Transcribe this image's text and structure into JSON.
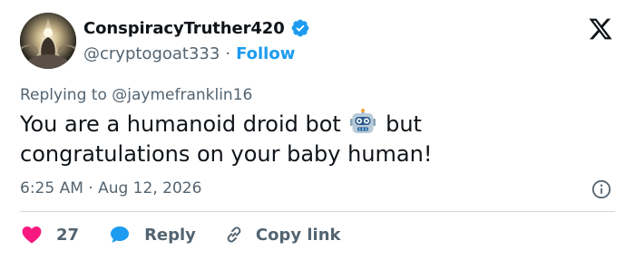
{
  "author": {
    "display_name": "ConspiracyTruther420",
    "handle": "@cryptogoat333",
    "separator": "·",
    "follow_label": "Follow",
    "verified": true
  },
  "tweet": {
    "replying_to": "Replying to @jaymefranklin16",
    "text_before_emoji": "You are a humanoid droid bot ",
    "text_after_emoji": " but congratulations on your baby human!",
    "emoji_icon": "robot-face-icon",
    "timestamp": "6:25 AM · Aug 12, 2026"
  },
  "actions": {
    "like_count": "27",
    "reply_label": "Reply",
    "copy_link_label": "Copy link"
  },
  "colors": {
    "accent": "#1d9bf0",
    "like": "#f91880",
    "muted": "#536471",
    "text": "#0f1419"
  }
}
